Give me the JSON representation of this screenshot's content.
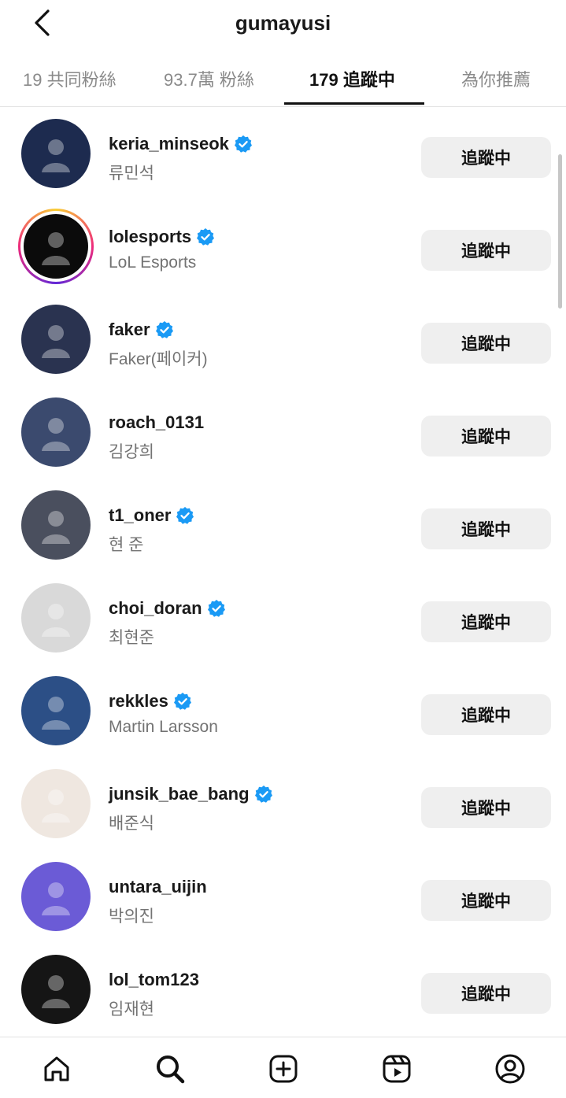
{
  "header": {
    "title": "gumayusi"
  },
  "tabs": [
    {
      "label": "19 共同粉絲"
    },
    {
      "label": "93.7萬 粉絲"
    },
    {
      "label": "179 追蹤中"
    },
    {
      "label": "為你推薦"
    }
  ],
  "follow_label": "追蹤中",
  "accounts": [
    {
      "username": "keria_minseok",
      "name": "류민석",
      "verified": true,
      "avatar_color": "#1d2b4f"
    },
    {
      "username": "lolesports",
      "name": "LoL Esports",
      "verified": true,
      "avatar_color": "#0b0b0b"
    },
    {
      "username": "faker",
      "name": "Faker(페이커)",
      "verified": true,
      "avatar_color": "#2a3350"
    },
    {
      "username": "roach_0131",
      "name": "김강희",
      "verified": false,
      "avatar_color": "#3b4a6e"
    },
    {
      "username": "t1_oner",
      "name": "현 준",
      "verified": true,
      "avatar_color": "#4a4f5e"
    },
    {
      "username": "choi_doran",
      "name": "최현준",
      "verified": true,
      "avatar_color": "#d9d9d9"
    },
    {
      "username": "rekkles",
      "name": "Martin Larsson",
      "verified": true,
      "avatar_color": "#2c4f86"
    },
    {
      "username": "junsik_bae_bang",
      "name": "배준식",
      "verified": true,
      "avatar_color": "#efe7e0"
    },
    {
      "username": "untara_uijin",
      "name": "박의진",
      "verified": false,
      "avatar_color": "#6b5bd6"
    },
    {
      "username": "lol_tom123",
      "name": "임재현",
      "verified": false,
      "avatar_color": "#151515"
    }
  ],
  "icons": {
    "back": "chevron-left-icon",
    "verified": "verified-badge-icon",
    "nav": [
      "home-icon",
      "search-icon",
      "create-icon",
      "reels-icon",
      "profile-icon"
    ]
  },
  "colors": {
    "verified": "#1a9af5",
    "follow_button_bg": "#efefef",
    "muted_text": "#737373"
  }
}
